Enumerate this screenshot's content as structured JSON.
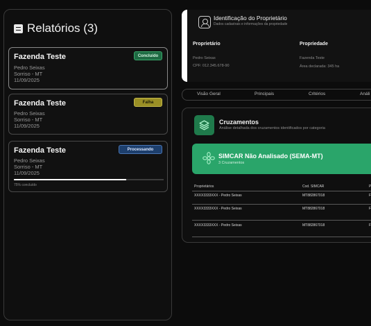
{
  "sidebar": {
    "title": "Relatórios (3)",
    "reports": [
      {
        "name": "Fazenda Teste",
        "owner": "Pedro Seixas",
        "location": "Sorriso - MT",
        "date": "11/09/2025",
        "status": "Concluído"
      },
      {
        "name": "Fazenda Teste",
        "owner": "Pedro Seixas",
        "location": "Sorriso - MT",
        "date": "11/09/2025",
        "status": "Falha"
      },
      {
        "name": "Fazenda Teste",
        "owner": "Pedro Seixas",
        "location": "Sorriso - MT",
        "date": "11/09/2025",
        "status": "Processando",
        "progress_percent": 75,
        "progress_label": "75% concluído"
      }
    ]
  },
  "owner_card": {
    "title": "Identificação do Proprietário",
    "subtitle": "Dados cadastrais e informações da propriedade",
    "proprietario": {
      "label": "Proprietário",
      "name": "Pedro Seixas",
      "cpf": "CPF: 012.345.678-90"
    },
    "propriedade": {
      "label": "Propriedade",
      "name": "Fazenda Teste",
      "area": "Área declarada: 345 ha"
    }
  },
  "tabs": [
    "Visão Geral",
    "Principais",
    "Critérios",
    "Análi"
  ],
  "cruzamentos": {
    "title": "Cruzamentos",
    "subtitle": "Análise detalhada dos cruzamentos identificados por categoria",
    "banner": {
      "title": "SIMCAR Não Analisado (SEMA-MT)",
      "subtitle": "3 Cruzamentos"
    },
    "table": {
      "headers": [
        "Proprietários",
        "Cod. SIMCAR",
        "P"
      ],
      "rows": [
        [
          "XXXX3333XXX - Pedro Seixas",
          "MT882867018",
          "F"
        ],
        [
          "XXXX3333XXX - Pedro Seixas",
          "MT882867018",
          "F"
        ],
        [
          "XXXX3333XXX - Pedro Seixas",
          "MT882867018",
          "F"
        ]
      ]
    }
  },
  "colors": {
    "background": "#0c0c0c",
    "accent_green": "#2aa56a",
    "badge_concluido": "#1e6a43",
    "badge_falha": "#9a8f25",
    "badge_processando": "#1d3f6d"
  },
  "icons": {
    "sidebar_title": "document-icon",
    "owner_card": "user-icon",
    "cruzamentos": "layers-icon",
    "banner": "flower-icon"
  }
}
